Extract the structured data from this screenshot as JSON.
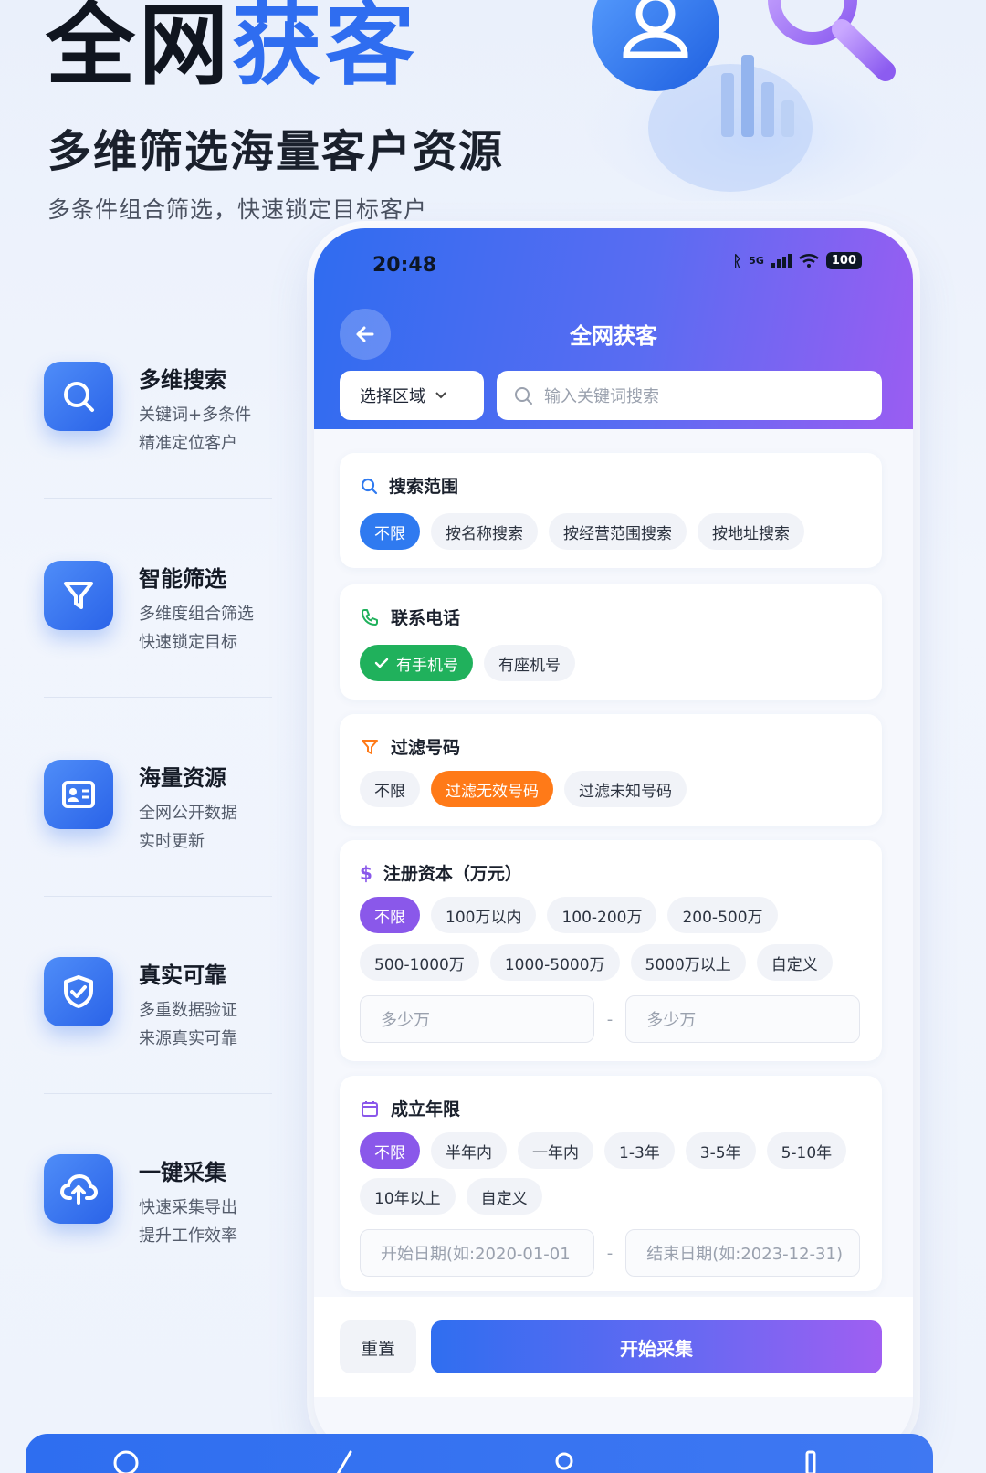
{
  "hero": {
    "title_part1": "全网",
    "title_part2": "获客",
    "subtitle": "多维筛选海量客户资源",
    "description": "多条件组合筛选，快速锁定目标客户"
  },
  "features": [
    {
      "title": "多维搜索",
      "line1": "关键词+多条件",
      "line2": "精准定位客户",
      "icon": "search-icon"
    },
    {
      "title": "智能筛选",
      "line1": "多维度组合筛选",
      "line2": "快速锁定目标",
      "icon": "filter-icon"
    },
    {
      "title": "海量资源",
      "line1": "全网公开数据",
      "line2": "实时更新",
      "icon": "id-card-icon"
    },
    {
      "title": "真实可靠",
      "line1": "多重数据验证",
      "line2": "来源真实可靠",
      "icon": "shield-check-icon"
    },
    {
      "title": "一键采集",
      "line1": "快速采集导出",
      "line2": "提升工作效率",
      "icon": "cloud-upload-icon"
    }
  ],
  "phone": {
    "status_time": "20:48",
    "network": "5G",
    "battery": "100",
    "nav_title": "全网获客",
    "region_select": "选择区域",
    "search_placeholder": "输入关键词搜索",
    "sections": {
      "scope": {
        "title": "搜索范围",
        "options": [
          "不限",
          "按名称搜索",
          "按经营范围搜索",
          "按地址搜索"
        ],
        "selected": "不限"
      },
      "phone": {
        "title": "联系电话",
        "options": [
          "有手机号",
          "有座机号"
        ],
        "selected": "有手机号"
      },
      "filter": {
        "title": "过滤号码",
        "options": [
          "不限",
          "过滤无效号码",
          "过滤未知号码"
        ],
        "selected": "过滤无效号码"
      },
      "capital": {
        "title": "注册资本（万元）",
        "row1": [
          "不限",
          "100万以内",
          "100-200万",
          "200-500万"
        ],
        "row2": [
          "500-1000万",
          "1000-5000万",
          "5000万以上",
          "自定义"
        ],
        "selected": "不限",
        "min_placeholder": "多少万",
        "max_placeholder": "多少万",
        "separator": "-"
      },
      "years": {
        "title": "成立年限",
        "row1": [
          "不限",
          "半年内",
          "一年内",
          "1-3年",
          "3-5年",
          "5-10年"
        ],
        "row2": [
          "10年以上",
          "自定义"
        ],
        "selected": "不限",
        "start_placeholder": "开始日期(如:2020-01-01",
        "end_placeholder": "结束日期(如:2023-12-31)",
        "separator": "-"
      }
    },
    "reset_label": "重置",
    "start_label": "开始采集"
  },
  "colors": {
    "primary": "#2f6df0",
    "green": "#20b15c",
    "orange": "#ff7a18",
    "purple": "#8a58ea"
  }
}
